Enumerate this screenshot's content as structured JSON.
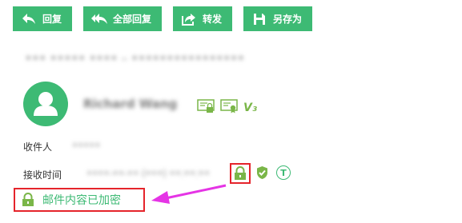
{
  "toolbar": {
    "reply_label": "回复",
    "reply_all_label": "全部回复",
    "forward_label": "转发",
    "save_as_label": "另存为"
  },
  "header": {
    "subject": "•••  ••••• •••• – ••••••••••••••••"
  },
  "sender": {
    "name": "Richard Wang",
    "badge": "V₃"
  },
  "fields": {
    "recipient_label": "收件人",
    "recipient_value": "•••••",
    "received_time_label": "接收时间",
    "received_time_value": "••••-••-•• (•••) ••:••:••"
  },
  "encryption": {
    "notice": "邮件内容已加密",
    "t_badge": "T"
  },
  "colors": {
    "accent_green": "#3dba74",
    "highlight_red": "#e5242b",
    "arrow_magenta": "#e534e5"
  },
  "icons": [
    "reply-icon",
    "reply-all-icon",
    "forward-icon",
    "save-as-icon",
    "avatar-person-icon",
    "certificate-lock-icon",
    "certificate-badge-icon",
    "lock-icon",
    "shield-check-icon"
  ]
}
